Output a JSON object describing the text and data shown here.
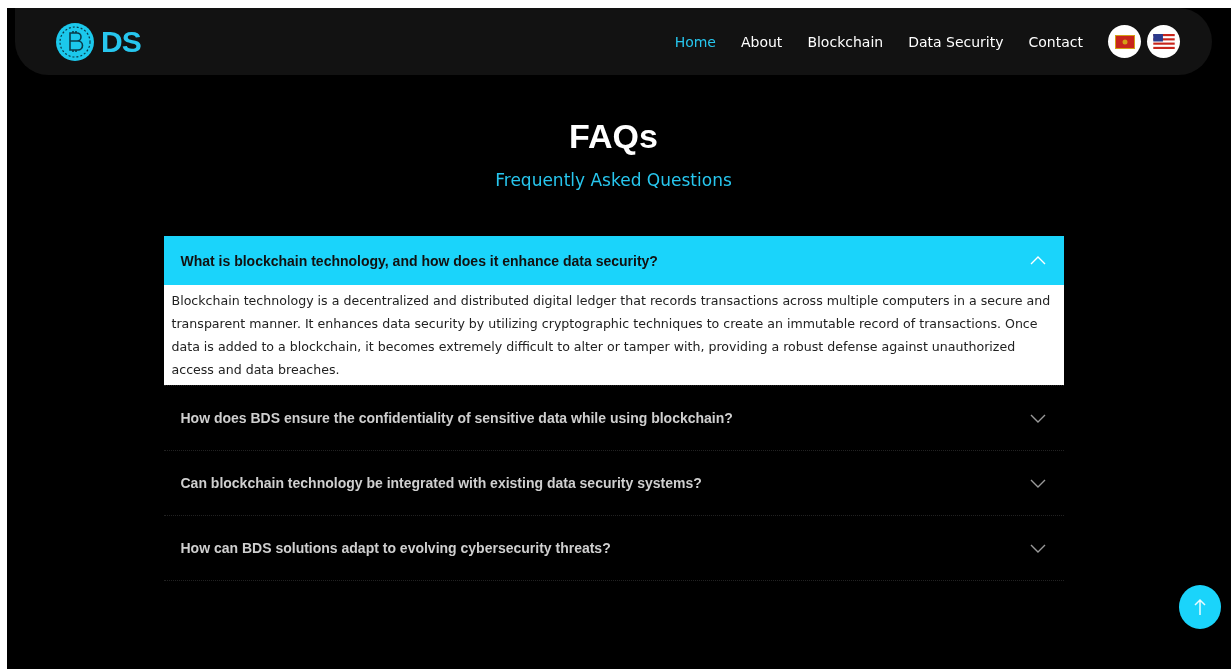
{
  "logo": {
    "text": "DS"
  },
  "nav": [
    {
      "label": "Home",
      "selected": true
    },
    {
      "label": "About",
      "selected": false
    },
    {
      "label": "Blockchain",
      "selected": false
    },
    {
      "label": "Data Security",
      "selected": false
    },
    {
      "label": "Contact",
      "selected": false
    }
  ],
  "languages": [
    {
      "kind": "montenegro"
    },
    {
      "kind": "usa"
    }
  ],
  "heading": "FAQs",
  "subheading": "Frequently Asked Questions",
  "faqs": [
    {
      "question": "What is blockchain technology, and how does it enhance data security?",
      "expanded": true,
      "answer": "Blockchain technology is a decentralized and distributed digital ledger that records transactions across multiple computers in a secure and transparent manner. It enhances data security by utilizing cryptographic techniques to create an immutable record of transactions. Once data is added to a blockchain, it becomes extremely difficult to alter or tamper with, providing a robust defense against unauthorized access and data breaches."
    },
    {
      "question": "How does BDS ensure the confidentiality of sensitive data while using blockchain?",
      "expanded": false
    },
    {
      "question": "Can blockchain technology be integrated with existing data security systems?",
      "expanded": false
    },
    {
      "question": "How can BDS solutions adapt to evolving cybersecurity threats?",
      "expanded": false
    }
  ]
}
